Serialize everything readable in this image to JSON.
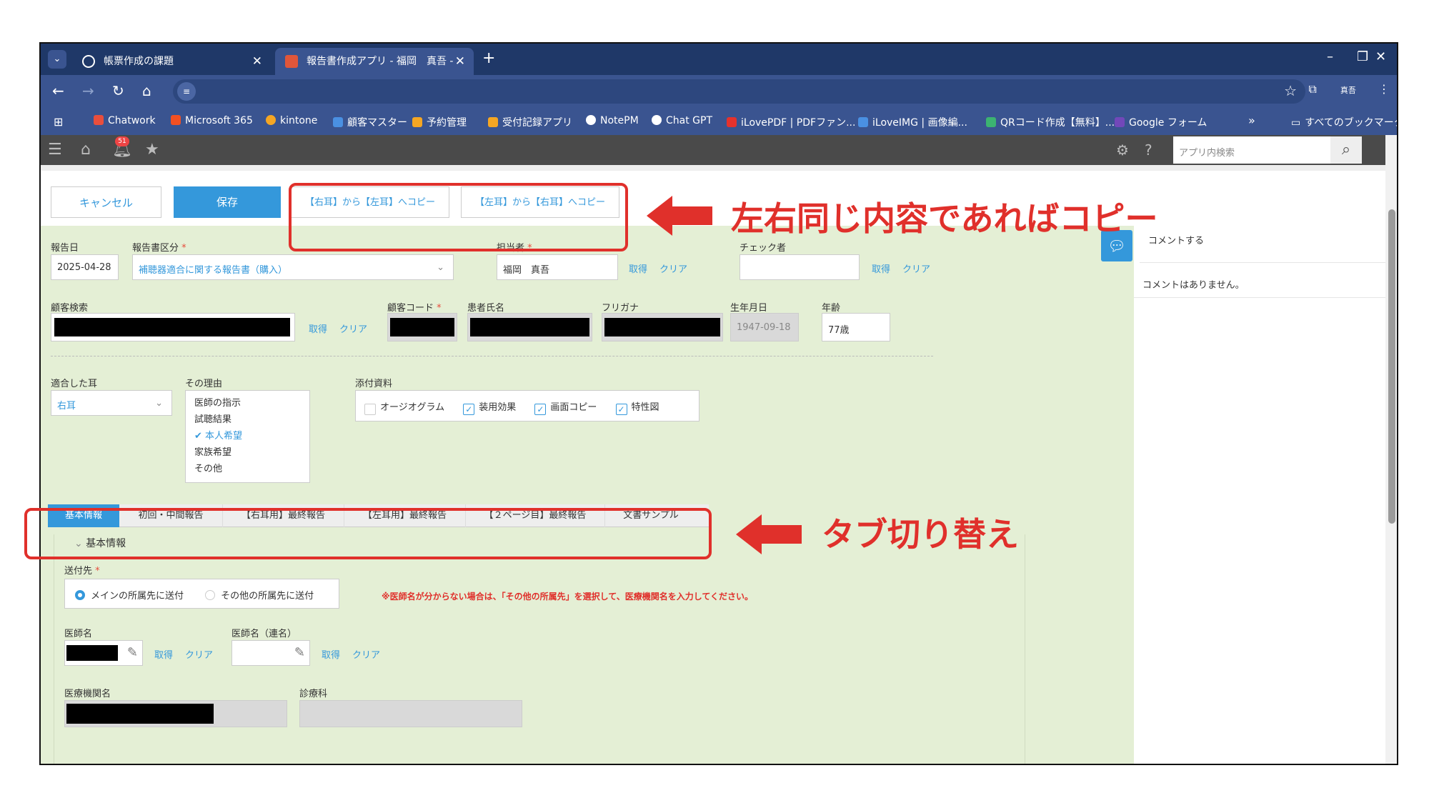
{
  "browser": {
    "tabs": [
      {
        "title": "帳票作成の課題"
      },
      {
        "title": "報告書作成アプリ - 福岡　真吾 -"
      }
    ],
    "new_tab": "+",
    "window_controls": [
      "–",
      "❐",
      "✕"
    ],
    "profile": "真吾",
    "bookmarks": [
      {
        "label": "Chatwork",
        "color": "#e94e3c"
      },
      {
        "label": "Microsoft 365",
        "color": "#f25022"
      },
      {
        "label": "kintone",
        "color": "#f5a623"
      },
      {
        "label": "顧客マスター",
        "color": "#4a90e2"
      },
      {
        "label": "予約管理",
        "color": "#f5a623"
      },
      {
        "label": "受付記録アプリ",
        "color": "#f5a623"
      },
      {
        "label": "NotePM",
        "color": "#ffffff"
      },
      {
        "label": "Chat GPT",
        "color": "#ffffff"
      },
      {
        "label": "iLovePDF | PDFファン...",
        "color": "#e5322d"
      },
      {
        "label": "iLoveIMG | 画像編...",
        "color": "#4a90e2"
      },
      {
        "label": "QRコード作成【無料】...",
        "color": "#3cb371"
      },
      {
        "label": "Google フォーム",
        "color": "#7248b9"
      }
    ],
    "bookmarks_more": "»",
    "all_bookmarks": "すべてのブックマーク"
  },
  "kintone": {
    "notification_count": "51",
    "search_placeholder": "アプリ内検索"
  },
  "actions": {
    "cancel": "キャンセル",
    "save": "保存",
    "copy_r_to_l": "【右耳】から【左耳】へコピー",
    "copy_l_to_r": "【左耳】から【右耳】へコピー"
  },
  "annotations": {
    "copy_note": "左右同じ内容であればコピー",
    "tab_note": "タブ切り替え"
  },
  "form": {
    "report_date_label": "報告日",
    "report_date": "2025-04-28",
    "report_type_label": "報告書区分",
    "report_type": "補聴器適合に関する報告書（購入）",
    "staff_label": "担当者",
    "staff": "福岡　真吾",
    "checker_label": "チェック者",
    "fetch": "取得",
    "clear": "クリア",
    "customer_search_label": "顧客検索",
    "customer_code_label": "顧客コード",
    "patient_name_label": "患者氏名",
    "furigana_label": "フリガナ",
    "birthdate_label": "生年月日",
    "birthdate": "1947-09-18",
    "age_label": "年齢",
    "age": "77歳",
    "fitted_ear_label": "適合した耳",
    "fitted_ear": "右耳",
    "reason_label": "その理由",
    "reasons": [
      "医師の指示",
      "試聴結果",
      "本人希望",
      "家族希望",
      "その他"
    ],
    "reason_selected": "本人希望",
    "attachments_label": "添付資料",
    "attachments": [
      {
        "label": "オージオグラム",
        "checked": false
      },
      {
        "label": "装用効果",
        "checked": true
      },
      {
        "label": "画面コピー",
        "checked": true
      },
      {
        "label": "特性図",
        "checked": true
      }
    ],
    "tabs": [
      "基本情報",
      "初回・中間報告",
      "【右耳用】最終報告",
      "【左耳用】最終報告",
      "【２ページ目】最終報告",
      "文書サンプル"
    ],
    "active_tab": "基本情報",
    "section_title": "基本情報",
    "send_to_label": "送付先",
    "send_to_options": [
      "メインの所属先に送付",
      "その他の所属先に送付"
    ],
    "send_to_warning": "※医師名が分からない場合は、「その他の所属先」を選択して、医療機関名を入力してください。",
    "doctor_label": "医師名",
    "doctor_alt_label": "医師名（連名）",
    "institution_label": "医療機関名",
    "department_label": "診療科"
  },
  "sidebar": {
    "comment_input": "コメントする",
    "no_comments": "コメントはありません。"
  }
}
